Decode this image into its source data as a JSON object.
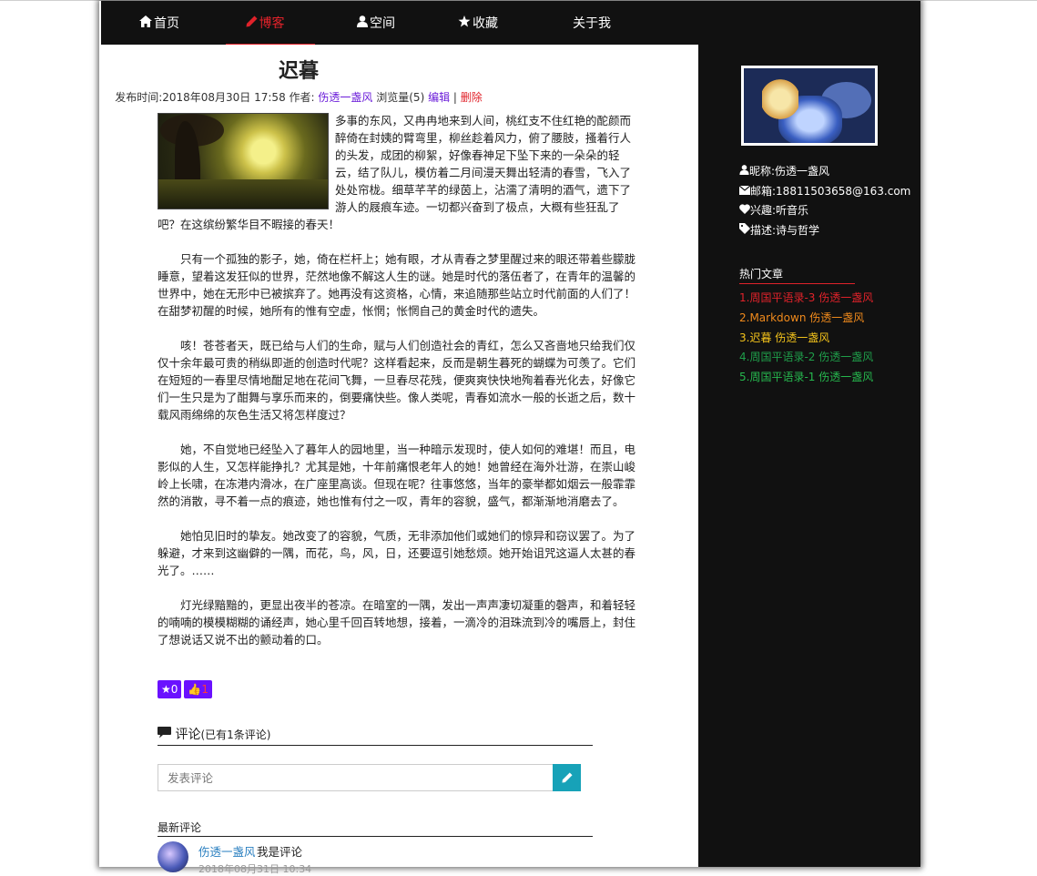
{
  "nav": {
    "items": [
      {
        "icon": "home-icon",
        "label": "首页"
      },
      {
        "icon": "pencil-icon",
        "label": "博客"
      },
      {
        "icon": "user-icon",
        "label": "空间"
      },
      {
        "icon": "star-icon",
        "label": "收藏"
      },
      {
        "icon": "",
        "label": "关于我"
      }
    ],
    "active_color": "#e0222a"
  },
  "article": {
    "title": "迟暮",
    "meta_prefix": "发布时间:2018年08月30日 17:58 作者:",
    "author": "伤透一盏风",
    "views": "浏览量(5)",
    "edit": "编辑",
    "separator": "|",
    "delete": "删除",
    "paragraphs": [
      "多事的东风，又冉冉地来到人间，桃红支不住红艳的酡颜而醉倚在封姨的臂弯里，柳丝趁着风力，俯了腰肢，搔着行人的头发，成团的柳絮，好像春神足下坠下来的一朵朵的轻云，结了队儿，模仿着二月间漫天舞出轻清的春雪，飞入了处处帘栊。细草芊芊的绿茵上，沾濡了清明的酒气，遗下了游人的屐痕车迹。一切都兴奋到了极点，大概有些狂乱了吧？在这缤纷繁华目不暇接的春天！",
      "只有一个孤独的影子，她，倚在栏杆上；她有眼，才从青春之梦里醒过来的眼还带着些朦胧睡意，望着这发狂似的世界，茫然地像不解这人生的谜。她是时代的落伍者了，在青年的温馨的世界中，她在无形中已被摈弃了。她再没有这资格，心情，来追随那些站立时代前面的人们了！在甜梦初醒的时候，她所有的惟有空虚，怅惘；怅惘自己的黄金时代的遗失。",
      "咳！苍苍者天，既已给与人们的生命，赋与人们创造社会的青红，怎么又吝啬地只给我们仅仅十余年最可贵的稍纵即逝的创造时代呢？这样看起来，反而是朝生暮死的蝴蝶为可羡了。它们在短短的一春里尽情地酣足地在花间飞舞，一旦春尽花残，便爽爽快快地殉着春光化去，好像它们一生只是为了酣舞与享乐而来的，倒要痛快些。像人类呢，青春如流水一般的长逝之后，数十载风雨绵绵的灰色生活又将怎样度过？",
      "她，不自觉地已经坠入了暮年人的园地里，当一种暗示发现时，使人如何的难堪！而且，电影似的人生，又怎样能挣扎？尤其是她，十年前痛恨老年人的她！她曾经在海外壮游，在崇山峻岭上长啸，在冻港内滑冰，在广座里高谈。但现在呢？往事悠悠，当年的豪举都如烟云一般霏霏然的消散，寻不着一点的痕迹，她也惟有付之一叹，青年的容貌，盛气，都渐渐地消磨去了。",
      "她怕见旧时的挚友。她改变了的容貌，气质，无非添加他们或她们的惊异和窃议罢了。为了躲避，才来到这幽僻的一隅，而花，鸟，风，日，还要逗引她愁烦。她开始诅咒这逼人太甚的春光了。……",
      "灯光绿黯黯的，更显出夜半的苍凉。在暗室的一隅，发出一声声凄切凝重的磬声，和着轻轻的喃喃的模模糊糊的诵经声，她心里千回百转地想，接着，一滴冷的泪珠流到冷的嘴唇上，封住了想说话又说不出的颤动着的口。"
    ],
    "fav_button": "★0",
    "like_button": "👍1"
  },
  "comments": {
    "heading": "评论",
    "count_text": "(已有1条评论)",
    "input_placeholder": "发表评论",
    "latest_label": "最新评论",
    "items": [
      {
        "user": "伤透一盏风",
        "text": "我是评论",
        "time": "2018年08月31日 10:34"
      }
    ]
  },
  "sidebar": {
    "nickname": "昵称:伤透一盏风",
    "email": "邮箱:18811503658@163.com",
    "interest": "兴趣:听音乐",
    "description": "描述:诗与哲学",
    "hot_title": "热门文章",
    "hot_items": [
      {
        "label": "1.周国平语录-3 伤透一盏风",
        "color": "#e0222a"
      },
      {
        "label": "2.Markdown 伤透一盏风",
        "color": "#f08a1c"
      },
      {
        "label": "3.迟暮 伤透一盏风",
        "color": "#f2c21b"
      },
      {
        "label": "4.周国平语录-2 伤透一盏风",
        "color": "#1f9e4a"
      },
      {
        "label": "5.周国平语录-1 伤透一盏风",
        "color": "#26b84e"
      }
    ]
  }
}
